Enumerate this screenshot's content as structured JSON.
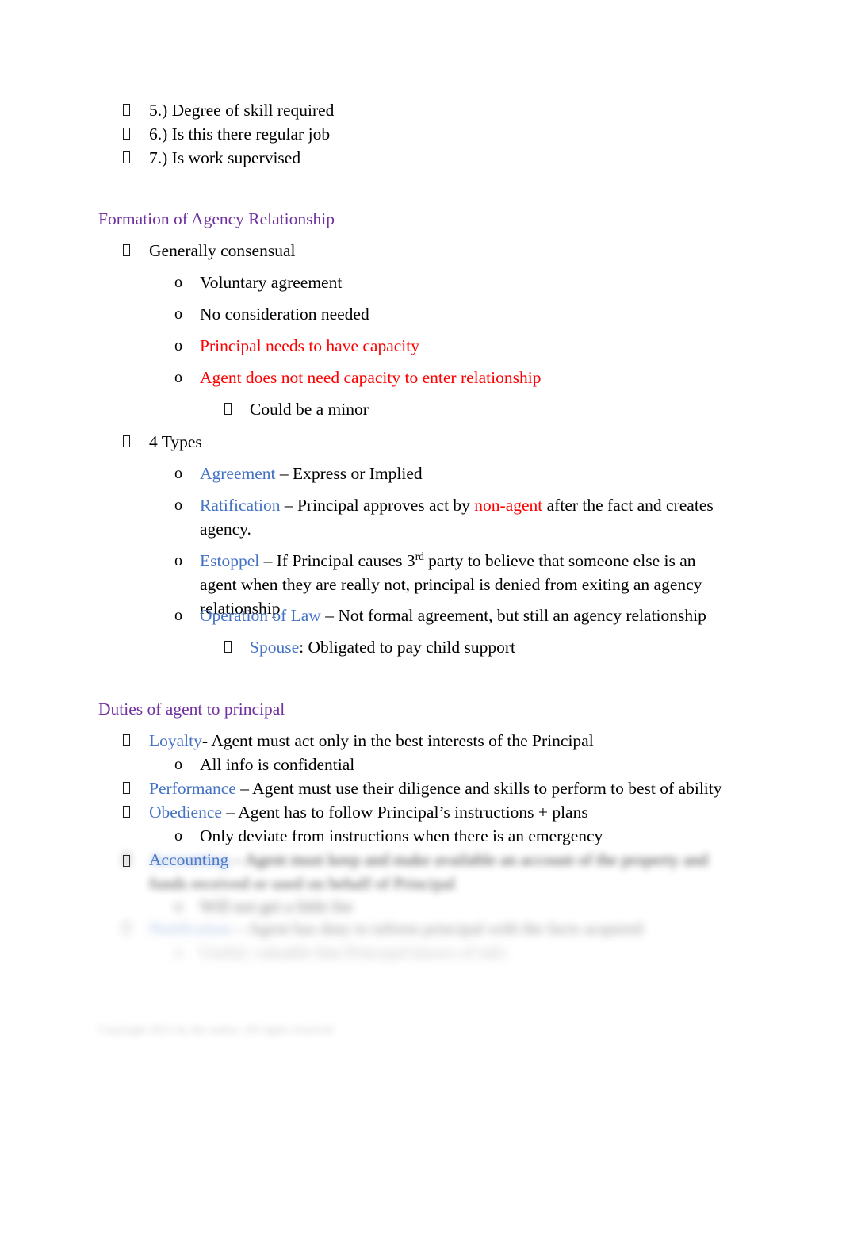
{
  "document": {
    "type": "study-outline",
    "colors": {
      "heading_purple": "#7030A0",
      "term_blue": "#4472C4",
      "emphasis_red": "#FF0000",
      "body_black": "#000000",
      "page_background": "#FFFFFF"
    },
    "bullet_glyphs": {
      "level1": "▯",
      "level2": "o",
      "level3": "▯"
    }
  },
  "top_list": {
    "items": [
      {
        "text": "5.) Degree of skill required"
      },
      {
        "text": "6.) Is this there regular job"
      },
      {
        "text": "7.) Is work supervised"
      }
    ]
  },
  "section_formation": {
    "heading": "Formation of Agency Relationship",
    "item_generally": "Generally consensual",
    "sub_voluntary": "Voluntary agreement",
    "sub_no_consideration": "No consideration needed",
    "sub_principal_capacity": "Principal needs to have capacity",
    "sub_agent_capacity": "Agent does not need capacity to enter relationship",
    "sub_could_be_minor": "Could be a minor",
    "item_four_types": "4 Types",
    "type_agreement_term": "Agreement",
    "type_agreement_rest": " – Express or Implied",
    "type_ratification_term": "Ratification",
    "type_ratification_part1": " – Principal approves act by ",
    "type_ratification_redword": "non-agent",
    "type_ratification_part2": " after the fact and creates agency.",
    "type_estoppel_term": "Estoppel",
    "type_estoppel_part1": " – If Principal causes 3",
    "type_estoppel_sup": "rd",
    "type_estoppel_part2": " party to believe that someone else is an agent when they are really not, principal is denied from exiting an agency relationship",
    "type_operation_term": "Operation of Law",
    "type_operation_rest": " – Not formal agreement, but still an agency relationship",
    "spouse_term": "Spouse",
    "spouse_rest": ": Obligated to pay child support"
  },
  "section_duties": {
    "heading": "Duties of agent to principal",
    "loyalty_term": "Loyalty",
    "loyalty_rest": "- Agent must act only in the best interests of the Principal",
    "loyalty_sub": "All info is confidential",
    "performance_term": "Performance",
    "performance_rest": " – Agent must use their diligence and skills to perform to best of ability",
    "obedience_term": "Obedience",
    "obedience_rest": " – Agent has to follow Principal’s instructions + plans",
    "obedience_sub": "Only deviate from instructions when there is an emergency",
    "accounting_term": "Accounting",
    "accounting_rest": " – Agent must keep and make available an account of the property and funds received or used on behalf of Principal",
    "accounting_sub": "Will not get a little fee",
    "notification_term": "Notification",
    "notification_rest": " – Agent has duty to inform principal with the facts acquired",
    "notification_sub": "Useful, valuable that Principal knows of info"
  },
  "footer": {
    "text": "Copyright 2021 by the author. All rights reserved."
  }
}
